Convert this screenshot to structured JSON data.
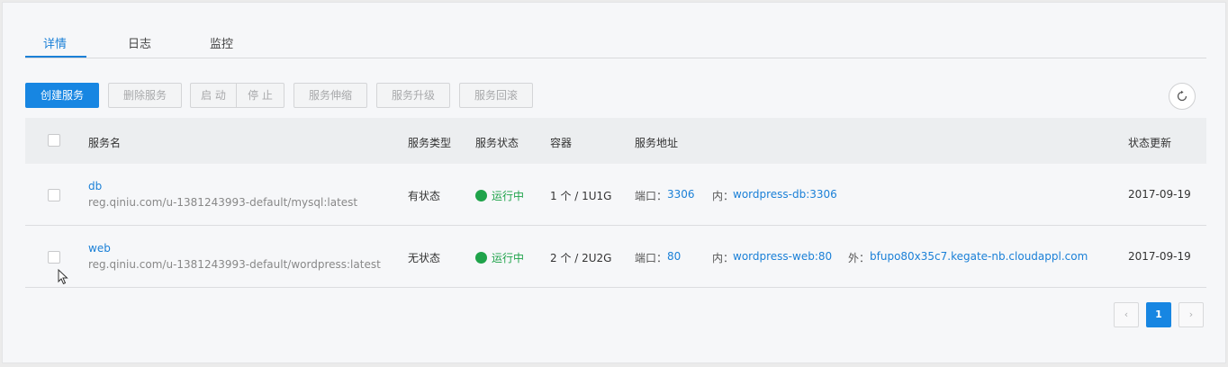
{
  "tabs": [
    {
      "label": "详情",
      "active": true
    },
    {
      "label": "日志",
      "active": false
    },
    {
      "label": "监控",
      "active": false
    }
  ],
  "toolbar": {
    "create": "创建服务",
    "delete": "删除服务",
    "start": "启 动",
    "stop": "停 止",
    "scale": "服务伸缩",
    "upgrade": "服务升级",
    "rollback": "服务回滚",
    "refresh_icon": "refresh-icon"
  },
  "table": {
    "headers": {
      "name": "服务名",
      "type": "服务类型",
      "status": "服务状态",
      "container": "容器",
      "address": "服务地址",
      "updated": "状态更新"
    },
    "rows": [
      {
        "name": "db",
        "image": "reg.qiniu.com/u-1381243993-default/mysql:latest",
        "type": "有状态",
        "status": "运行中",
        "container": "1 个 / 1U1G",
        "port_label": "端口：",
        "port": "3306",
        "internal_label": "内：",
        "internal": "wordpress-db:3306",
        "external_label": "",
        "external": "",
        "updated": "2017-09-19"
      },
      {
        "name": "web",
        "image": "reg.qiniu.com/u-1381243993-default/wordpress:latest",
        "type": "无状态",
        "status": "运行中",
        "container": "2 个 / 2U2G",
        "port_label": "端口：",
        "port": "80",
        "internal_label": "内：",
        "internal": "wordpress-web:80",
        "external_label": "外：",
        "external": "bfupo80x35c7.kegate-nb.cloudappl.com",
        "updated": "2017-09-19"
      }
    ]
  },
  "pagination": {
    "prev": "‹",
    "current": "1",
    "next": "›"
  },
  "colors": {
    "accent": "#1786e2",
    "running": "#1fa34a"
  }
}
